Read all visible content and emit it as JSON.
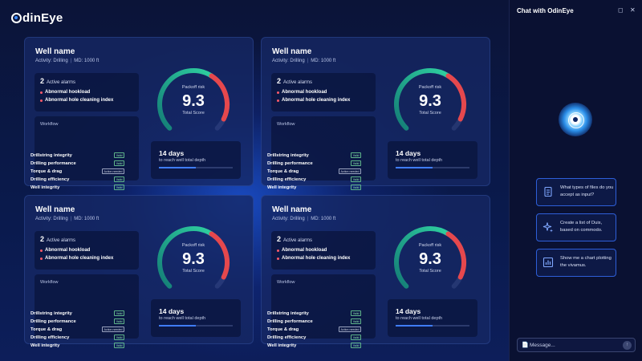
{
  "app": {
    "logo_text": "dinEye"
  },
  "cards": [
    {
      "title": "Well name",
      "activity": "Activity: Drilling",
      "md": "MD: 1000 ft",
      "alarms": {
        "count": "2",
        "label": "Active alarms",
        "items": [
          "Abnormal hookload",
          "Abnormal hole cleaning index"
        ]
      },
      "workflow": {
        "title": "Workflow",
        "rows": [
          {
            "name": "Drillstring integrity",
            "status": "Valid"
          },
          {
            "name": "Drilling performance",
            "status": "Valid"
          },
          {
            "name": "Torque & drag",
            "status": "Action needed"
          },
          {
            "name": "Drilling efficiency",
            "status": "Valid"
          },
          {
            "name": "Well integrity",
            "status": "Valid"
          }
        ]
      },
      "gauge": {
        "label": "Packoff risk",
        "score": "9.3",
        "score_value": 9.3,
        "max": 10,
        "subtitle": "Total Score"
      },
      "days": {
        "value": "14 days",
        "subtitle": "to reach well total depth",
        "progress": 0.5
      }
    },
    {
      "title": "Well name",
      "activity": "Activity: Drilling",
      "md": "MD: 1000 ft",
      "alarms": {
        "count": "2",
        "label": "Active alarms",
        "items": [
          "Abnormal hookload",
          "Abnormal hole cleaning index"
        ]
      },
      "workflow": {
        "title": "Workflow",
        "rows": [
          {
            "name": "Drillstring integrity",
            "status": "Valid"
          },
          {
            "name": "Drilling performance",
            "status": "Valid"
          },
          {
            "name": "Torque & drag",
            "status": "Action needed"
          },
          {
            "name": "Drilling efficiency",
            "status": "Valid"
          },
          {
            "name": "Well integrity",
            "status": "Valid"
          }
        ]
      },
      "gauge": {
        "label": "Packoff risk",
        "score": "9.3",
        "score_value": 9.3,
        "max": 10,
        "subtitle": "Total Score"
      },
      "days": {
        "value": "14 days",
        "subtitle": "to reach well total depth",
        "progress": 0.5
      }
    },
    {
      "title": "Well name",
      "activity": "Activity: Drilling",
      "md": "MD: 1000 ft",
      "alarms": {
        "count": "2",
        "label": "Active alarms",
        "items": [
          "Abnormal hookload",
          "Abnormal hole cleaning index"
        ]
      },
      "workflow": {
        "title": "Workflow",
        "rows": [
          {
            "name": "Drillstring integrity",
            "status": "Valid"
          },
          {
            "name": "Drilling performance",
            "status": "Valid"
          },
          {
            "name": "Torque & drag",
            "status": "Action needed"
          },
          {
            "name": "Drilling efficiency",
            "status": "Valid"
          },
          {
            "name": "Well integrity",
            "status": "Valid"
          }
        ]
      },
      "gauge": {
        "label": "Packoff risk",
        "score": "9.3",
        "score_value": 9.3,
        "max": 10,
        "subtitle": "Total Score"
      },
      "days": {
        "value": "14 days",
        "subtitle": "to reach well total depth",
        "progress": 0.5
      }
    },
    {
      "title": "Well name",
      "activity": "Activity: Drilling",
      "md": "MD: 1000 ft",
      "alarms": {
        "count": "2",
        "label": "Active alarms",
        "items": [
          "Abnormal hookload",
          "Abnormal hole cleaning index"
        ]
      },
      "workflow": {
        "title": "Workflow",
        "rows": [
          {
            "name": "Drillstring integrity",
            "status": "Valid"
          },
          {
            "name": "Drilling performance",
            "status": "Valid"
          },
          {
            "name": "Torque & drag",
            "status": "Action needed"
          },
          {
            "name": "Drilling efficiency",
            "status": "Valid"
          },
          {
            "name": "Well integrity",
            "status": "Valid"
          }
        ]
      },
      "gauge": {
        "label": "Packoff risk",
        "score": "9.3",
        "score_value": 9.3,
        "max": 10,
        "subtitle": "Total Score"
      },
      "days": {
        "value": "14 days",
        "subtitle": "to reach well total depth",
        "progress": 0.5
      }
    }
  ],
  "chat": {
    "title": "Chat with OdinEye",
    "suggestions": [
      {
        "icon": "document-icon",
        "text": "What types of files do you accept as input?"
      },
      {
        "icon": "sparkle-icon",
        "text": "Create a list of Duis, based on commodo."
      },
      {
        "icon": "bar-chart-icon",
        "text": "Show me a chart plotting the vivamus."
      }
    ],
    "message_placeholder": "Message..."
  },
  "colors": {
    "accent": "#3f7cff",
    "alarm": "#ff5a6a",
    "gauge_green": "#1fb58f",
    "gauge_red": "#e5484d"
  }
}
